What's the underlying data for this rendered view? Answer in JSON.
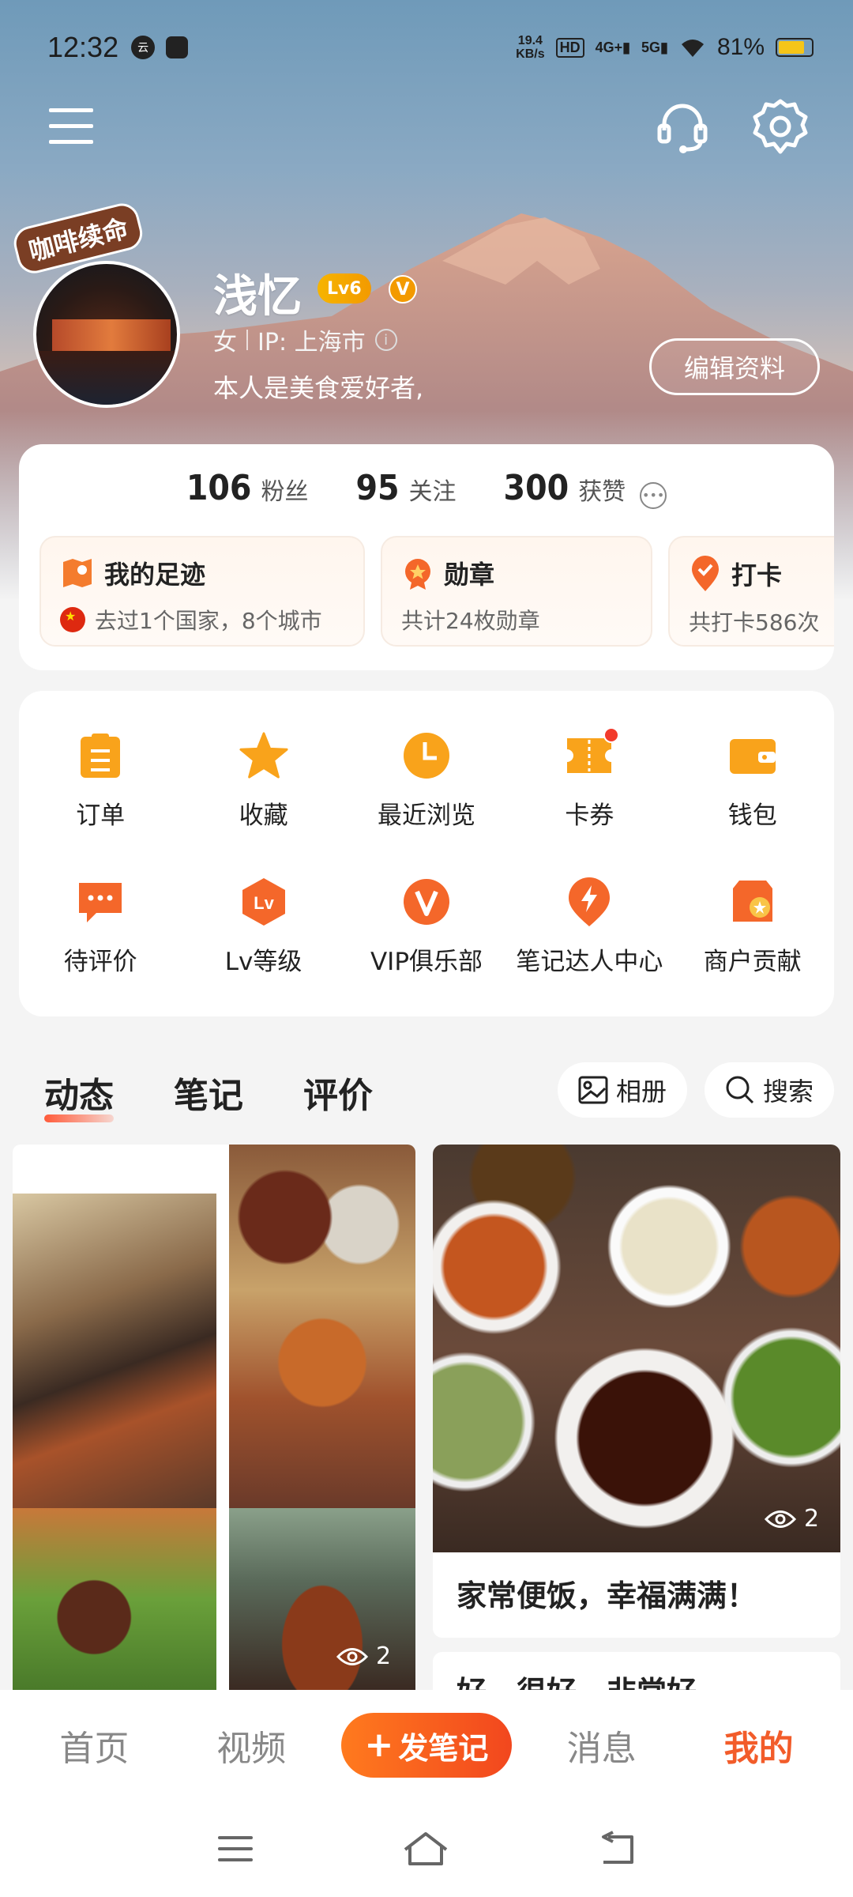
{
  "status_bar": {
    "time": "12:32",
    "cloud_icon_text": "云",
    "speed_value": "19.4",
    "speed_unit": "KB/s",
    "hd_label": "HD",
    "net1": "4G+",
    "net2": "5G",
    "battery_percent": "81%",
    "battery_level": 0.81,
    "battery_color": "#f5c518"
  },
  "topbar": {
    "menu_icon": "menu-icon",
    "support_icon": "headset-icon",
    "settings_icon": "gear-icon"
  },
  "profile": {
    "avatar_pendant": "咖啡续命",
    "name": "浅忆",
    "level_badge": "Lv6",
    "verified_badge": "V",
    "gender": "女",
    "ip_location": "IP: 上海市",
    "bio": "本人是美食爱好者,",
    "edit_button": "编辑资料"
  },
  "stats": [
    {
      "value": "106",
      "label": "粉丝"
    },
    {
      "value": "95",
      "label": "关注"
    },
    {
      "value": "300",
      "label": "获赞"
    }
  ],
  "chips": [
    {
      "title": "我的足迹",
      "subtitle": "去过1个国家，8个城市",
      "icon": "map-icon"
    },
    {
      "title": "勋章",
      "subtitle": "共计24枚勋章",
      "icon": "medal-icon"
    },
    {
      "title": "打卡",
      "subtitle": "共打卡586次",
      "icon": "checkin-icon"
    }
  ],
  "services": [
    {
      "label": "订单",
      "icon": "order-icon"
    },
    {
      "label": "收藏",
      "icon": "star-icon"
    },
    {
      "label": "最近浏览",
      "icon": "clock-icon"
    },
    {
      "label": "卡券",
      "icon": "coupon-icon",
      "has_dot": true
    },
    {
      "label": "钱包",
      "icon": "wallet-icon"
    },
    {
      "label": "待评价",
      "icon": "comment-icon"
    },
    {
      "label": "Lv等级",
      "icon": "level-icon"
    },
    {
      "label": "VIP俱乐部",
      "icon": "vip-icon"
    },
    {
      "label": "笔记达人中心",
      "icon": "lightning-icon"
    },
    {
      "label": "商户贡献",
      "icon": "shop-icon"
    }
  ],
  "tabs": [
    {
      "label": "动态",
      "active": true
    },
    {
      "label": "笔记",
      "active": false
    },
    {
      "label": "评价",
      "active": false
    }
  ],
  "album_button": "相册",
  "search_button": "搜索",
  "feed": {
    "left_views": "2",
    "right_views": "2",
    "right_caption": "家常便饭，幸福满满！",
    "next_caption": "好，很好，非常好"
  },
  "bottom_nav": {
    "home": "首页",
    "video": "视频",
    "post": "发笔记",
    "messages": "消息",
    "mine": "我的",
    "accent_color": "#f25c2a"
  }
}
